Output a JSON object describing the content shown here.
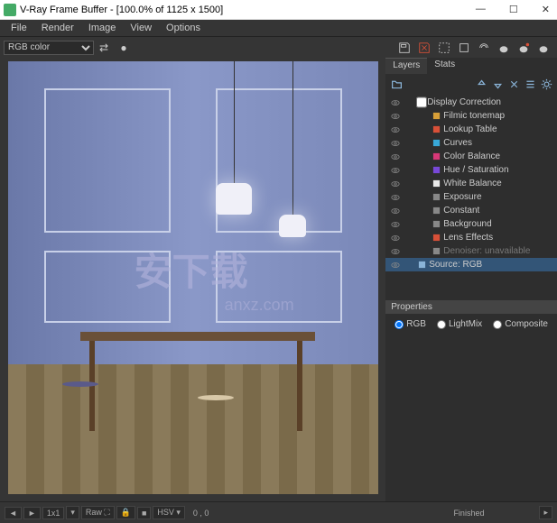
{
  "window": {
    "title": "V-Ray Frame Buffer - [100.0% of 1125 x 1500]",
    "min": "—",
    "max": "☐",
    "close": "✕"
  },
  "menu": {
    "file": "File",
    "render": "Render",
    "image": "Image",
    "view": "View",
    "options": "Options"
  },
  "channel": {
    "selected": "RGB color"
  },
  "tabs": {
    "layers": "Layers",
    "stats": "Stats"
  },
  "layers": {
    "display_correction": "Display Correction",
    "items": [
      {
        "name": "Filmic tonemap",
        "color": "#d8a038"
      },
      {
        "name": "Lookup Table",
        "color": "#d85038"
      },
      {
        "name": "Curves",
        "color": "#38a8d8"
      },
      {
        "name": "Color Balance",
        "color": "#d83878"
      },
      {
        "name": "Hue / Saturation",
        "color": "#7848d8"
      },
      {
        "name": "White Balance",
        "color": "#e8e8e8"
      },
      {
        "name": "Exposure",
        "color": "#888"
      },
      {
        "name": "Constant",
        "color": "#888"
      },
      {
        "name": "Background",
        "color": "#888"
      },
      {
        "name": "Lens Effects",
        "color": "#d85038"
      },
      {
        "name": "Denoiser: unavailable",
        "color": "#888",
        "dim": true
      }
    ],
    "source": "Source: RGB"
  },
  "properties": {
    "title": "Properties",
    "rgb": "RGB",
    "lightmix": "LightMix",
    "composite": "Composite"
  },
  "status": {
    "scale": "1x1",
    "raw": "Raw",
    "hsv": "HSV",
    "coords": "0 , 0",
    "state": "Finished"
  },
  "watermark": {
    "main": "安下载",
    "sub": "anxz.com"
  }
}
